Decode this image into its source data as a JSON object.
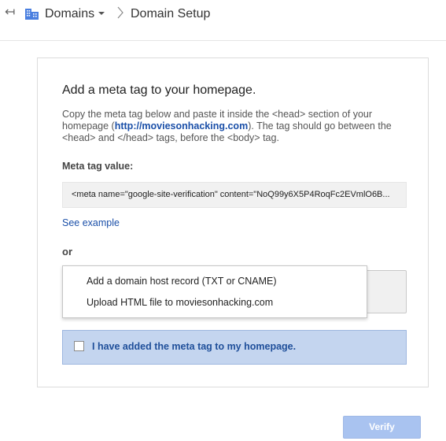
{
  "header": {
    "breadcrumb_parent": "Domains",
    "breadcrumb_current": "Domain Setup",
    "back_icon": "back-arrow-icon",
    "domains_icon": "building-icon"
  },
  "card": {
    "title": "Add a meta tag to your homepage.",
    "description_before": "Copy the meta tag below and paste it inside the <head> section of your homepage (",
    "description_link": "http://moviesonhacking.com",
    "description_after": "). The tag should go between the <head> and </head> tags, before the <body> tag.",
    "meta_label": "Meta tag value:",
    "meta_value": "<meta name=\"google-site-verification\" content=\"NoQ99y6X5P4RoqFc2EVmlO6B...",
    "see_example": "See example",
    "or_label": "or",
    "dropdown_options": [
      "Add a domain host record (TXT or CNAME)",
      "Upload HTML file to moviesonhacking.com"
    ],
    "checkbox_label": "I have added the meta tag to my homepage.",
    "checkbox_checked": false
  },
  "footer": {
    "verify_label": "Verify"
  },
  "colors": {
    "link": "#1a4fa8",
    "brand_blue": "#4a7fe0",
    "checkbox_row_bg": "#c4d5ef",
    "verify_button_bg": "#a9c3f0"
  }
}
